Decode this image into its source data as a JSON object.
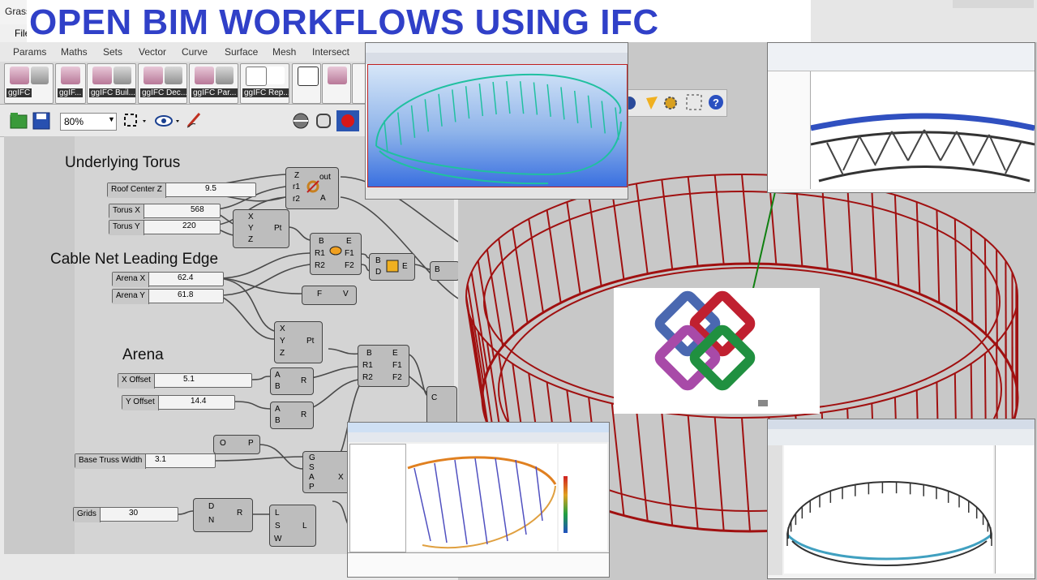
{
  "title": "OPEN BIM WORKFLOWS USING IFC",
  "grasshopper": {
    "window_title": "Grass",
    "menu": [
      "File"
    ],
    "tabs": [
      "Params",
      "Maths",
      "Sets",
      "Vector",
      "Curve",
      "Surface",
      "Mesh",
      "Intersect"
    ],
    "toolbar": [
      "ggIFC",
      "ggIF...",
      "ggIFC Buil...",
      "ggIFC Dec...",
      "ggIFC Par...",
      "ggIFC Rep...",
      "",
      "",
      ""
    ],
    "zoom": "80%",
    "groups": {
      "torus": "Underlying Torus",
      "cable": "Cable Net Leading Edge",
      "arena": "Arena"
    },
    "sliders": [
      {
        "name": "Roof Center Z",
        "value": "9.5"
      },
      {
        "name": "Torus X",
        "value": "568"
      },
      {
        "name": "Torus Y",
        "value": "220"
      },
      {
        "name": "Arena X",
        "value": "62.4"
      },
      {
        "name": "Arena Y",
        "value": "61.8"
      },
      {
        "name": "X Offset",
        "value": "5.1"
      },
      {
        "name": "Y Offset",
        "value": "14.4"
      },
      {
        "name": "Base Truss Width",
        "value": "3.1"
      },
      {
        "name": "Grids",
        "value": "30"
      }
    ],
    "components": {
      "torus": {
        "inputs": [
          "Z",
          "r1",
          "r2"
        ],
        "outputs": [
          "out",
          "A"
        ]
      },
      "pt1": {
        "inputs": [
          "X",
          "Y",
          "Z"
        ],
        "output": "Pt"
      },
      "ellipse1": {
        "inputs": [
          "B",
          "R1",
          "R2"
        ],
        "outputs": [
          "E",
          "F1",
          "F2"
        ]
      },
      "bd": {
        "inputs": [
          "B",
          "D"
        ],
        "output": "E"
      },
      "b_small": {
        "input": "B"
      },
      "fz": {
        "inputs": [
          "F"
        ],
        "output": "V"
      },
      "pt2": {
        "inputs": [
          "X",
          "Y",
          "Z"
        ],
        "output": "Pt"
      },
      "ellipse2": {
        "inputs": [
          "B",
          "R1",
          "R2"
        ],
        "outputs": [
          "E",
          "F1",
          "F2"
        ]
      },
      "sub1": {
        "inputs": [
          "A",
          "B"
        ],
        "output": "R"
      },
      "sub2": {
        "inputs": [
          "A",
          "B"
        ],
        "output": "R"
      },
      "neg": {
        "input": "O",
        "output": "P"
      },
      "gsap": {
        "inputs": [
          "G",
          "S",
          "A",
          "P"
        ],
        "output": "X"
      },
      "dnr": {
        "inputs": [
          "D",
          "N"
        ],
        "output": "R"
      },
      "lsw": {
        "inputs": [
          "L",
          "S",
          "W"
        ],
        "output": "L"
      },
      "c": {
        "input": "C"
      }
    }
  },
  "colors": {
    "title": "#3040c8",
    "truss_red": "#a01010",
    "cyan_truss": "#20c0a0",
    "viewport_bg": "#c8c8c8"
  }
}
